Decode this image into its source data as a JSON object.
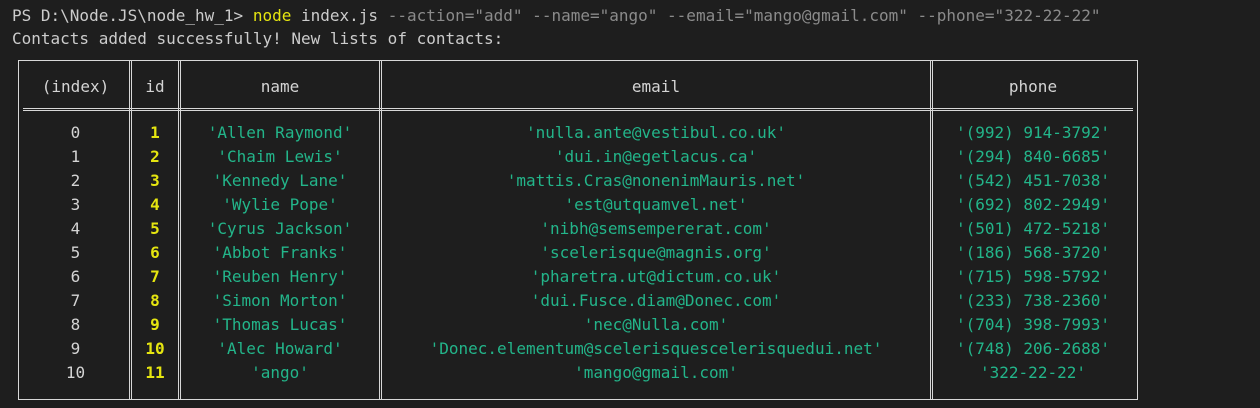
{
  "prompt": {
    "ps_path": "PS D:\\Node.JS\\node_hw_1> ",
    "command": "node",
    "file": " index.js ",
    "args": "--action=\"add\" --name=\"ango\" --email=\"mango@gmail.com\" --phone=\"322-22-22\""
  },
  "message": "Contacts added successfully! New lists of contacts:",
  "table": {
    "headers": [
      "(index)",
      "id",
      "name",
      "email",
      "phone"
    ],
    "rows": [
      {
        "index": "0",
        "id": "1",
        "name": "'Allen Raymond'",
        "email": "'nulla.ante@vestibul.co.uk'",
        "phone": "'(992) 914-3792'"
      },
      {
        "index": "1",
        "id": "2",
        "name": "'Chaim Lewis'",
        "email": "'dui.in@egetlacus.ca'",
        "phone": "'(294) 840-6685'"
      },
      {
        "index": "2",
        "id": "3",
        "name": "'Kennedy Lane'",
        "email": "'mattis.Cras@nonenimMauris.net'",
        "phone": "'(542) 451-7038'"
      },
      {
        "index": "3",
        "id": "4",
        "name": "'Wylie Pope'",
        "email": "'est@utquamvel.net'",
        "phone": "'(692) 802-2949'"
      },
      {
        "index": "4",
        "id": "5",
        "name": "'Cyrus Jackson'",
        "email": "'nibh@semsempererat.com'",
        "phone": "'(501) 472-5218'"
      },
      {
        "index": "5",
        "id": "6",
        "name": "'Abbot Franks'",
        "email": "'scelerisque@magnis.org'",
        "phone": "'(186) 568-3720'"
      },
      {
        "index": "6",
        "id": "7",
        "name": "'Reuben Henry'",
        "email": "'pharetra.ut@dictum.co.uk'",
        "phone": "'(715) 598-5792'"
      },
      {
        "index": "7",
        "id": "8",
        "name": "'Simon Morton'",
        "email": "'dui.Fusce.diam@Donec.com'",
        "phone": "'(233) 738-2360'"
      },
      {
        "index": "8",
        "id": "9",
        "name": "'Thomas Lucas'",
        "email": "'nec@Nulla.com'",
        "phone": "'(704) 398-7993'"
      },
      {
        "index": "9",
        "id": "10",
        "name": "'Alec Howard'",
        "email": "'Donec.elementum@scelerisquescelerisquedui.net'",
        "phone": "'(748) 206-2688'"
      },
      {
        "index": "10",
        "id": "11",
        "name": "'ango'",
        "email": "'mango@gmail.com'",
        "phone": "'322-22-22'"
      }
    ]
  }
}
